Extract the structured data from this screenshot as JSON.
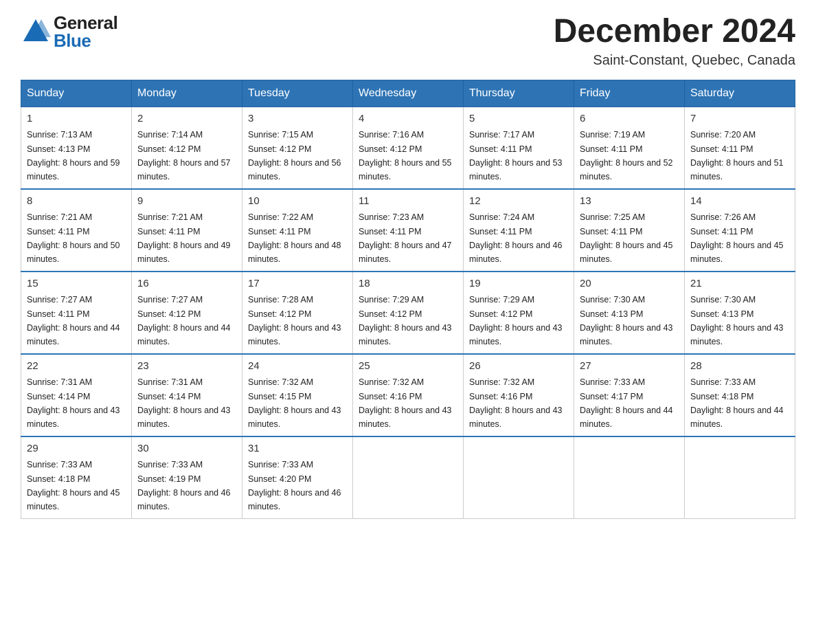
{
  "header": {
    "logo_line1": "General",
    "logo_line2": "Blue",
    "main_title": "December 2024",
    "subtitle": "Saint-Constant, Quebec, Canada"
  },
  "calendar": {
    "days_of_week": [
      "Sunday",
      "Monday",
      "Tuesday",
      "Wednesday",
      "Thursday",
      "Friday",
      "Saturday"
    ],
    "weeks": [
      [
        {
          "date": "1",
          "sunrise": "7:13 AM",
          "sunset": "4:13 PM",
          "daylight": "8 hours and 59 minutes."
        },
        {
          "date": "2",
          "sunrise": "7:14 AM",
          "sunset": "4:12 PM",
          "daylight": "8 hours and 57 minutes."
        },
        {
          "date": "3",
          "sunrise": "7:15 AM",
          "sunset": "4:12 PM",
          "daylight": "8 hours and 56 minutes."
        },
        {
          "date": "4",
          "sunrise": "7:16 AM",
          "sunset": "4:12 PM",
          "daylight": "8 hours and 55 minutes."
        },
        {
          "date": "5",
          "sunrise": "7:17 AM",
          "sunset": "4:11 PM",
          "daylight": "8 hours and 53 minutes."
        },
        {
          "date": "6",
          "sunrise": "7:19 AM",
          "sunset": "4:11 PM",
          "daylight": "8 hours and 52 minutes."
        },
        {
          "date": "7",
          "sunrise": "7:20 AM",
          "sunset": "4:11 PM",
          "daylight": "8 hours and 51 minutes."
        }
      ],
      [
        {
          "date": "8",
          "sunrise": "7:21 AM",
          "sunset": "4:11 PM",
          "daylight": "8 hours and 50 minutes."
        },
        {
          "date": "9",
          "sunrise": "7:21 AM",
          "sunset": "4:11 PM",
          "daylight": "8 hours and 49 minutes."
        },
        {
          "date": "10",
          "sunrise": "7:22 AM",
          "sunset": "4:11 PM",
          "daylight": "8 hours and 48 minutes."
        },
        {
          "date": "11",
          "sunrise": "7:23 AM",
          "sunset": "4:11 PM",
          "daylight": "8 hours and 47 minutes."
        },
        {
          "date": "12",
          "sunrise": "7:24 AM",
          "sunset": "4:11 PM",
          "daylight": "8 hours and 46 minutes."
        },
        {
          "date": "13",
          "sunrise": "7:25 AM",
          "sunset": "4:11 PM",
          "daylight": "8 hours and 45 minutes."
        },
        {
          "date": "14",
          "sunrise": "7:26 AM",
          "sunset": "4:11 PM",
          "daylight": "8 hours and 45 minutes."
        }
      ],
      [
        {
          "date": "15",
          "sunrise": "7:27 AM",
          "sunset": "4:11 PM",
          "daylight": "8 hours and 44 minutes."
        },
        {
          "date": "16",
          "sunrise": "7:27 AM",
          "sunset": "4:12 PM",
          "daylight": "8 hours and 44 minutes."
        },
        {
          "date": "17",
          "sunrise": "7:28 AM",
          "sunset": "4:12 PM",
          "daylight": "8 hours and 43 minutes."
        },
        {
          "date": "18",
          "sunrise": "7:29 AM",
          "sunset": "4:12 PM",
          "daylight": "8 hours and 43 minutes."
        },
        {
          "date": "19",
          "sunrise": "7:29 AM",
          "sunset": "4:12 PM",
          "daylight": "8 hours and 43 minutes."
        },
        {
          "date": "20",
          "sunrise": "7:30 AM",
          "sunset": "4:13 PM",
          "daylight": "8 hours and 43 minutes."
        },
        {
          "date": "21",
          "sunrise": "7:30 AM",
          "sunset": "4:13 PM",
          "daylight": "8 hours and 43 minutes."
        }
      ],
      [
        {
          "date": "22",
          "sunrise": "7:31 AM",
          "sunset": "4:14 PM",
          "daylight": "8 hours and 43 minutes."
        },
        {
          "date": "23",
          "sunrise": "7:31 AM",
          "sunset": "4:14 PM",
          "daylight": "8 hours and 43 minutes."
        },
        {
          "date": "24",
          "sunrise": "7:32 AM",
          "sunset": "4:15 PM",
          "daylight": "8 hours and 43 minutes."
        },
        {
          "date": "25",
          "sunrise": "7:32 AM",
          "sunset": "4:16 PM",
          "daylight": "8 hours and 43 minutes."
        },
        {
          "date": "26",
          "sunrise": "7:32 AM",
          "sunset": "4:16 PM",
          "daylight": "8 hours and 43 minutes."
        },
        {
          "date": "27",
          "sunrise": "7:33 AM",
          "sunset": "4:17 PM",
          "daylight": "8 hours and 44 minutes."
        },
        {
          "date": "28",
          "sunrise": "7:33 AM",
          "sunset": "4:18 PM",
          "daylight": "8 hours and 44 minutes."
        }
      ],
      [
        {
          "date": "29",
          "sunrise": "7:33 AM",
          "sunset": "4:18 PM",
          "daylight": "8 hours and 45 minutes."
        },
        {
          "date": "30",
          "sunrise": "7:33 AM",
          "sunset": "4:19 PM",
          "daylight": "8 hours and 46 minutes."
        },
        {
          "date": "31",
          "sunrise": "7:33 AM",
          "sunset": "4:20 PM",
          "daylight": "8 hours and 46 minutes."
        },
        null,
        null,
        null,
        null
      ]
    ]
  }
}
